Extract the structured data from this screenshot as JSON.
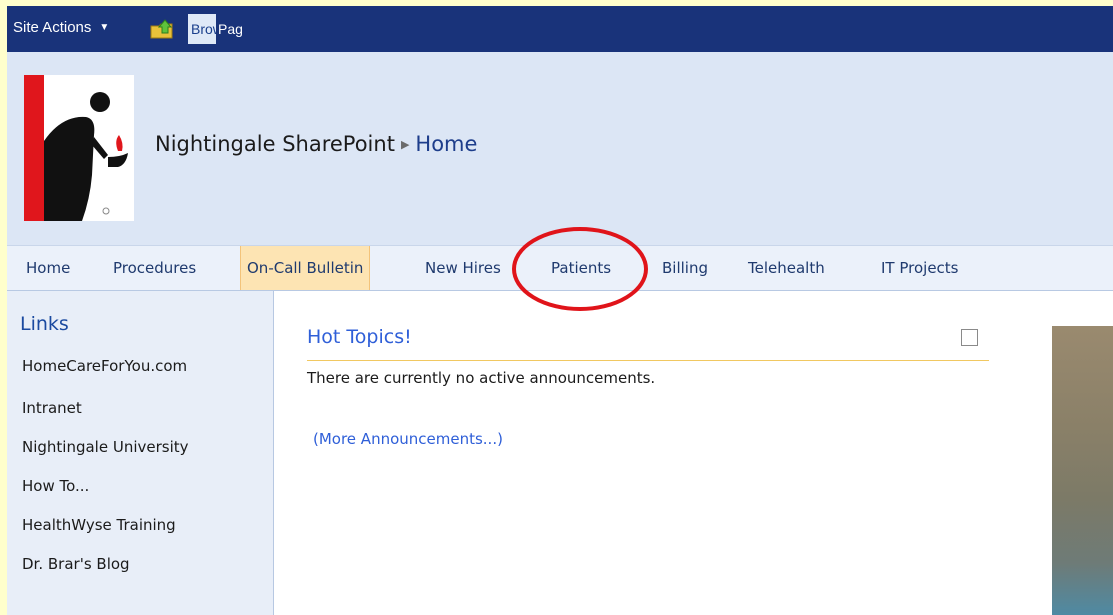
{
  "ribbon": {
    "site_actions": "Site Actions",
    "tab_browse": "Browse",
    "tab_page": "Page"
  },
  "header": {
    "site_name": "Nightingale SharePoint",
    "breadcrumb_current": "Home"
  },
  "topnav": {
    "items": [
      {
        "label": "Home"
      },
      {
        "label": "Procedures"
      },
      {
        "label": "On-Call Bulletin",
        "active": true
      },
      {
        "label": "New Hires"
      },
      {
        "label": "Patients"
      },
      {
        "label": "Billing"
      },
      {
        "label": "Telehealth"
      },
      {
        "label": "IT Projects"
      }
    ]
  },
  "quicklaunch": {
    "heading": "Links",
    "links": [
      "HomeCareForYou.com",
      "Intranet",
      "Nightingale University",
      "How To...",
      "HealthWyse Training",
      "Dr. Brar's Blog"
    ]
  },
  "webpart": {
    "title": "Hot Topics!",
    "empty_message": "There are currently no active announcements.",
    "more_link": "(More Announcements...)"
  },
  "colors": {
    "ribbon": "#19337a",
    "title_bg": "#dce6f5",
    "nav_bg": "#ebf1fa",
    "active_tab": "#fde4b3",
    "link_blue": "#2f5fd8",
    "annotation_red": "#e0141a",
    "page_border": "#ffffcc"
  }
}
